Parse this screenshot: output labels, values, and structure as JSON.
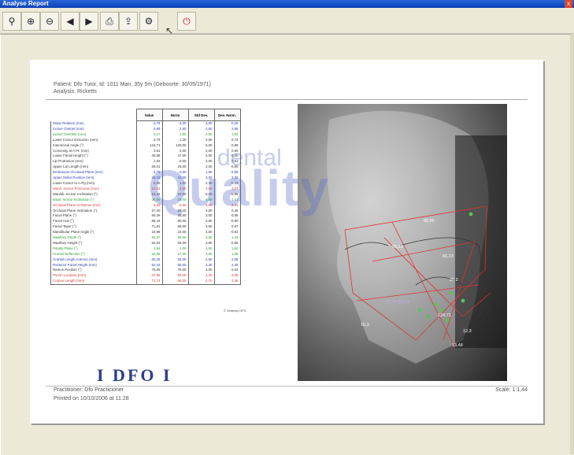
{
  "window": {
    "title": "Analyse Report",
    "close_glyph": "x"
  },
  "toolbar": [
    {
      "name": "zoom-icon"
    },
    {
      "name": "zoom-in-icon"
    },
    {
      "name": "zoom-out-icon"
    },
    {
      "name": "previous-icon"
    },
    {
      "name": "next-icon"
    },
    {
      "name": "print-icon"
    },
    {
      "name": "export-icon"
    },
    {
      "name": "settings-icon"
    },
    {
      "name": "exit-icon"
    }
  ],
  "report": {
    "patient": "Patient: Dfo Tutor, Id: 1011 Man, 35y 5m (Geboorte: 30/05/1971)",
    "analysis": "Analysis: Ricketts",
    "table_headers": [
      "",
      "Value",
      "Norm",
      "Std Dev.",
      "Dev. Norm."
    ],
    "rows": [
      {
        "label": "Molar Relation (mm)",
        "value": "-3,78",
        "norm": "-3,00",
        "sd": "3,00",
        "dev": "-0,26",
        "color": "#2d3bb3"
      },
      {
        "label": "Incisor Overjet (mm)",
        "value": "9,89",
        "norm": "2,50",
        "sd": "2,50",
        "dev": "2,96",
        "color": "#2d3bb3"
      },
      {
        "label": "Incisor Overbite (mm)",
        "value": "5,27",
        "norm": "2,50",
        "sd": "2,00",
        "dev": "1,53",
        "color": "#2e9b2e"
      },
      {
        "label": "Lower Incisor Extrusion (mm)",
        "value": "2,79",
        "norm": "1,30",
        "sd": "2,00",
        "dev": "0,74",
        "color": "#333"
      },
      {
        "label": "Interincisal Angle (°)",
        "value": "124,71",
        "norm": "130,00",
        "sd": "6,00",
        "dev": "-0,88",
        "color": "#333"
      },
      {
        "label": "Convexity at A Pt. (mm)",
        "value": "3,81",
        "norm": "2,00",
        "sd": "2,00",
        "dev": "0,90",
        "color": "#333"
      },
      {
        "label": "Lower Facial Height (°)",
        "value": "45,58",
        "norm": "47,00",
        "sd": "4,00",
        "dev": "-0,40",
        "color": "#333"
      },
      {
        "label": "Lip Protrusion (mm)",
        "value": "1,03",
        "norm": "0,00",
        "sd": "2,00",
        "dev": "0,52",
        "color": "#333"
      },
      {
        "label": "Upper Lip Length (mm)",
        "value": "25,01",
        "norm": "26,00",
        "sd": "2,00",
        "dev": "-0,50",
        "color": "#333"
      },
      {
        "label": "Embrasure-Occlusal Plane (mm)",
        "value": "-4,78",
        "norm": "-0,50",
        "sd": "1,50",
        "dev": "-2,85",
        "color": "#2d3bb3"
      },
      {
        "label": "Upper Molar Position (mm)",
        "value": "25,15",
        "norm": "15,00",
        "sd": "3,00",
        "dev": "3,38",
        "color": "#2d3bb3"
      },
      {
        "label": "Lower Incisor to A-Pg (mm)",
        "value": "0,25",
        "norm": "1,00",
        "sd": "2,30",
        "dev": "-0,32",
        "color": "#333"
      },
      {
        "label": "Mand. Incisor Protrusion (mm)",
        "value": "10,42",
        "norm": "2,50",
        "sd": "2,50",
        "dev": "3,07",
        "color": "#d23b3b"
      },
      {
        "label": "Mandib. Incisor Inclination (°)",
        "value": "15,42",
        "norm": "22,00",
        "sd": "6,00",
        "dev": "-0,85",
        "color": "#333"
      },
      {
        "label": "Maxil. Incisor Inclination (°)",
        "value": "35,06",
        "norm": "28,00",
        "sd": "4,00",
        "dev": "1,41",
        "color": "#2e9b2e"
      },
      {
        "label": "Occlusal Plane to Ramus (mm)",
        "value": "6,03",
        "norm": "-0,50",
        "sd": "3,00",
        "dev": "3,51",
        "color": "#d23b3b"
      },
      {
        "label": "Occlusal Plane Inclination (°)",
        "value": "27,00",
        "norm": "26,20",
        "sd": "4,00",
        "dev": "0,45",
        "color": "#333"
      },
      {
        "label": "Facial Plane (°)",
        "value": "90,26",
        "norm": "88,50",
        "sd": "3,00",
        "dev": "0,59",
        "color": "#333"
      },
      {
        "label": "Facial Axis (°)",
        "value": "86,44",
        "norm": "90,00",
        "sd": "3,50",
        "dev": "-0,90",
        "color": "#333"
      },
      {
        "label": "Facial Taper (°)",
        "value": "71,81",
        "norm": "68,00",
        "sd": "3,50",
        "dev": "0,97",
        "color": "#333"
      },
      {
        "label": "Mandibular Plane Angle (°)",
        "value": "18,98",
        "norm": "23,00",
        "sd": "4,50",
        "dev": "-0,92",
        "color": "#333"
      },
      {
        "label": "Maxillary Depth (°)",
        "value": "94,37",
        "norm": "90,00",
        "sd": "3,00",
        "dev": "1,42",
        "color": "#2e9b2e"
      },
      {
        "label": "Maxillary Height (°)",
        "value": "54,04",
        "norm": "56,00",
        "sd": "3,00",
        "dev": "-0,65",
        "color": "#333"
      },
      {
        "label": "Palatal Plane (°)",
        "value": "1,64",
        "norm": "1,00",
        "sd": "3,50",
        "dev": "1,60",
        "color": "#2e9b2e"
      },
      {
        "label": "Cranial Deflection (°)",
        "value": "32,06",
        "norm": "27,00",
        "sd": "3,00",
        "dev": "1,65",
        "color": "#2e9b2e"
      },
      {
        "label": "Cranial Length Anterior (mm)",
        "value": "60,26",
        "norm": "55,00",
        "sd": "2,50",
        "dev": "2,08",
        "color": "#2d3bb3"
      },
      {
        "label": "Posterior Facial Height (mm)",
        "value": "62,43",
        "norm": "55,00",
        "sd": "3,30",
        "dev": "2,25",
        "color": "#2d3bb3"
      },
      {
        "label": "Ramus Position (°)",
        "value": "76,05",
        "norm": "76,00",
        "sd": "3,00",
        "dev": "0,02",
        "color": "#333"
      },
      {
        "label": "Porion Location (mm)",
        "value": "-47,96",
        "norm": "-39,00",
        "sd": "2,20",
        "dev": "-4,05",
        "color": "#d23b3b"
      },
      {
        "label": "Corpus Length (mm)",
        "value": "71,74",
        "norm": "65,00",
        "sd": "2,70",
        "dev": "2,46",
        "color": "#d23b3b"
      }
    ],
    "credit": "© Vedecky DFO",
    "logo_text": "I DFO I",
    "watermark_small": "dental",
    "watermark_large": "Quality",
    "practitioner": "Practitioner: Dfo Practicioner",
    "printed_on": "Printed on 10/10/2006 at 11:28",
    "scale": "Scale: 1:1,44",
    "xray_labels": [
      "95,29",
      "66,23",
      "95,95",
      "20.2",
      "124,71",
      "12,3",
      "16,3",
      "27,00 16,2 s",
      "13,48"
    ]
  }
}
